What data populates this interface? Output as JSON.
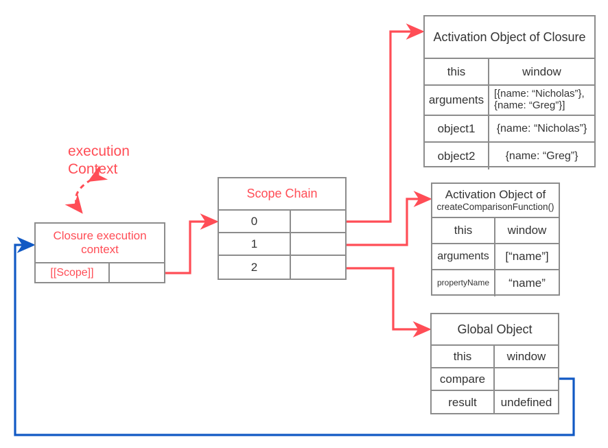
{
  "diagram": {
    "title_label": "execution\nContext",
    "accent_red": "#ff4d56",
    "accent_blue": "#1159c4",
    "border_gray": "#8c8c8c"
  },
  "execution_context_box": {
    "header": "Closure\nexecution context",
    "rows": [
      {
        "key": "[[Scope]]",
        "value": ""
      }
    ]
  },
  "scope_chain": {
    "header": "Scope Chain",
    "rows": [
      {
        "key": "0",
        "value": ""
      },
      {
        "key": "1",
        "value": ""
      },
      {
        "key": "2",
        "value": ""
      }
    ]
  },
  "activation_object_closure": {
    "header": "Activation Object of Closure",
    "rows": [
      {
        "key": "this",
        "value": "window"
      },
      {
        "key": "arguments",
        "value": "[{name: “Nicholas”}, {name: “Greg”}]"
      },
      {
        "key": "object1",
        "value": "{name: “Nicholas”}"
      },
      {
        "key": "object2",
        "value": "{name: “Greg”}"
      }
    ]
  },
  "activation_object_ccf": {
    "header_line1": "Activation Object of",
    "header_line2": "createComparisonFunction()",
    "rows": [
      {
        "key": "this",
        "value": "window"
      },
      {
        "key": "arguments",
        "value": "[“name”]"
      },
      {
        "key": "propertyName",
        "value": "“name”"
      }
    ]
  },
  "global_object": {
    "header": "Global Object",
    "rows": [
      {
        "key": "this",
        "value": "window"
      },
      {
        "key": "compare",
        "value": ""
      },
      {
        "key": "result",
        "value": "undefined"
      }
    ]
  }
}
